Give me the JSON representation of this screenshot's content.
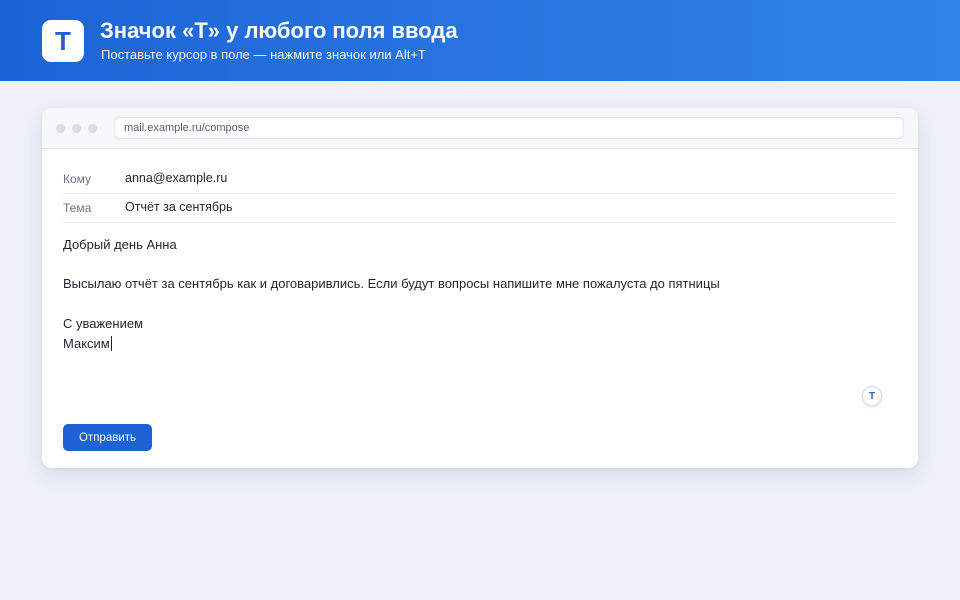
{
  "header": {
    "logo_letter": "T",
    "title": "Значок «T» у любого поля ввода",
    "subtitle": "Поставьте курсор в поле — нажмите значок или Alt+T"
  },
  "browser": {
    "url": "mail.example.ru/compose"
  },
  "compose": {
    "to_label": "Кому",
    "to_value": "anna@example.ru",
    "subject_label": "Тема",
    "subject_value": "Отчёт за сентябрь",
    "body_lines": [
      "Добрый день Анна",
      "Высылаю отчёт за сентябрь как и договаривлись. Если будут вопросы напишите мне пожалуста до пятницы",
      "С уважением",
      "Максим"
    ],
    "t_badge": "T",
    "send_label": "Отправить"
  },
  "colors": {
    "accent": "#1d63d6",
    "page_background": "#eef2f8"
  }
}
